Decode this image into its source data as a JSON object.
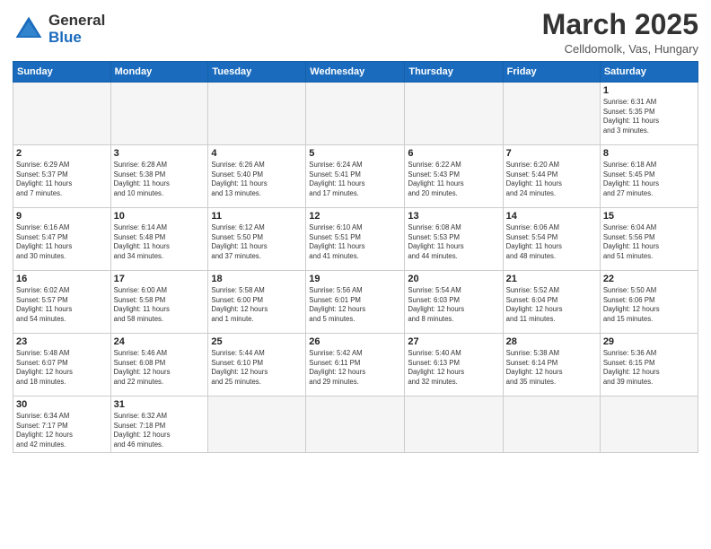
{
  "logo": {
    "line1": "General",
    "line2": "Blue"
  },
  "title": "March 2025",
  "subtitle": "Celldomolk, Vas, Hungary",
  "weekdays": [
    "Sunday",
    "Monday",
    "Tuesday",
    "Wednesday",
    "Thursday",
    "Friday",
    "Saturday"
  ],
  "weeks": [
    [
      {
        "num": "",
        "info": ""
      },
      {
        "num": "",
        "info": ""
      },
      {
        "num": "",
        "info": ""
      },
      {
        "num": "",
        "info": ""
      },
      {
        "num": "",
        "info": ""
      },
      {
        "num": "",
        "info": ""
      },
      {
        "num": "1",
        "info": "Sunrise: 6:31 AM\nSunset: 5:35 PM\nDaylight: 11 hours\nand 3 minutes."
      }
    ],
    [
      {
        "num": "2",
        "info": "Sunrise: 6:29 AM\nSunset: 5:37 PM\nDaylight: 11 hours\nand 7 minutes."
      },
      {
        "num": "3",
        "info": "Sunrise: 6:28 AM\nSunset: 5:38 PM\nDaylight: 11 hours\nand 10 minutes."
      },
      {
        "num": "4",
        "info": "Sunrise: 6:26 AM\nSunset: 5:40 PM\nDaylight: 11 hours\nand 13 minutes."
      },
      {
        "num": "5",
        "info": "Sunrise: 6:24 AM\nSunset: 5:41 PM\nDaylight: 11 hours\nand 17 minutes."
      },
      {
        "num": "6",
        "info": "Sunrise: 6:22 AM\nSunset: 5:43 PM\nDaylight: 11 hours\nand 20 minutes."
      },
      {
        "num": "7",
        "info": "Sunrise: 6:20 AM\nSunset: 5:44 PM\nDaylight: 11 hours\nand 24 minutes."
      },
      {
        "num": "8",
        "info": "Sunrise: 6:18 AM\nSunset: 5:45 PM\nDaylight: 11 hours\nand 27 minutes."
      }
    ],
    [
      {
        "num": "9",
        "info": "Sunrise: 6:16 AM\nSunset: 5:47 PM\nDaylight: 11 hours\nand 30 minutes."
      },
      {
        "num": "10",
        "info": "Sunrise: 6:14 AM\nSunset: 5:48 PM\nDaylight: 11 hours\nand 34 minutes."
      },
      {
        "num": "11",
        "info": "Sunrise: 6:12 AM\nSunset: 5:50 PM\nDaylight: 11 hours\nand 37 minutes."
      },
      {
        "num": "12",
        "info": "Sunrise: 6:10 AM\nSunset: 5:51 PM\nDaylight: 11 hours\nand 41 minutes."
      },
      {
        "num": "13",
        "info": "Sunrise: 6:08 AM\nSunset: 5:53 PM\nDaylight: 11 hours\nand 44 minutes."
      },
      {
        "num": "14",
        "info": "Sunrise: 6:06 AM\nSunset: 5:54 PM\nDaylight: 11 hours\nand 48 minutes."
      },
      {
        "num": "15",
        "info": "Sunrise: 6:04 AM\nSunset: 5:56 PM\nDaylight: 11 hours\nand 51 minutes."
      }
    ],
    [
      {
        "num": "16",
        "info": "Sunrise: 6:02 AM\nSunset: 5:57 PM\nDaylight: 11 hours\nand 54 minutes."
      },
      {
        "num": "17",
        "info": "Sunrise: 6:00 AM\nSunset: 5:58 PM\nDaylight: 11 hours\nand 58 minutes."
      },
      {
        "num": "18",
        "info": "Sunrise: 5:58 AM\nSunset: 6:00 PM\nDaylight: 12 hours\nand 1 minute."
      },
      {
        "num": "19",
        "info": "Sunrise: 5:56 AM\nSunset: 6:01 PM\nDaylight: 12 hours\nand 5 minutes."
      },
      {
        "num": "20",
        "info": "Sunrise: 5:54 AM\nSunset: 6:03 PM\nDaylight: 12 hours\nand 8 minutes."
      },
      {
        "num": "21",
        "info": "Sunrise: 5:52 AM\nSunset: 6:04 PM\nDaylight: 12 hours\nand 11 minutes."
      },
      {
        "num": "22",
        "info": "Sunrise: 5:50 AM\nSunset: 6:06 PM\nDaylight: 12 hours\nand 15 minutes."
      }
    ],
    [
      {
        "num": "23",
        "info": "Sunrise: 5:48 AM\nSunset: 6:07 PM\nDaylight: 12 hours\nand 18 minutes."
      },
      {
        "num": "24",
        "info": "Sunrise: 5:46 AM\nSunset: 6:08 PM\nDaylight: 12 hours\nand 22 minutes."
      },
      {
        "num": "25",
        "info": "Sunrise: 5:44 AM\nSunset: 6:10 PM\nDaylight: 12 hours\nand 25 minutes."
      },
      {
        "num": "26",
        "info": "Sunrise: 5:42 AM\nSunset: 6:11 PM\nDaylight: 12 hours\nand 29 minutes."
      },
      {
        "num": "27",
        "info": "Sunrise: 5:40 AM\nSunset: 6:13 PM\nDaylight: 12 hours\nand 32 minutes."
      },
      {
        "num": "28",
        "info": "Sunrise: 5:38 AM\nSunset: 6:14 PM\nDaylight: 12 hours\nand 35 minutes."
      },
      {
        "num": "29",
        "info": "Sunrise: 5:36 AM\nSunset: 6:15 PM\nDaylight: 12 hours\nand 39 minutes."
      }
    ],
    [
      {
        "num": "30",
        "info": "Sunrise: 6:34 AM\nSunset: 7:17 PM\nDaylight: 12 hours\nand 42 minutes."
      },
      {
        "num": "31",
        "info": "Sunrise: 6:32 AM\nSunset: 7:18 PM\nDaylight: 12 hours\nand 46 minutes."
      },
      {
        "num": "",
        "info": ""
      },
      {
        "num": "",
        "info": ""
      },
      {
        "num": "",
        "info": ""
      },
      {
        "num": "",
        "info": ""
      },
      {
        "num": "",
        "info": ""
      }
    ]
  ]
}
